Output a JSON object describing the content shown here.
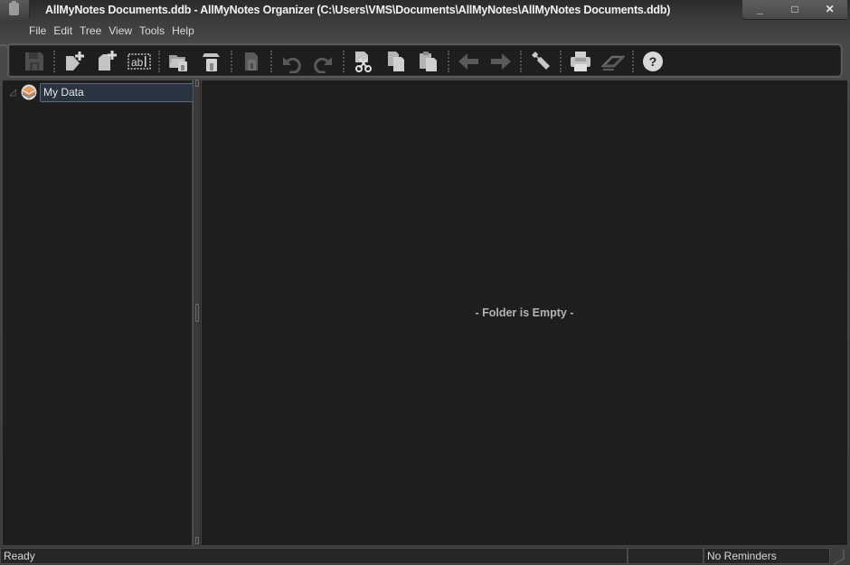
{
  "window": {
    "title": "AllMyNotes Documents.ddb - AllMyNotes Organizer (C:\\Users\\VMS\\Documents\\AllMyNotes\\AllMyNotes Documents.ddb)",
    "controls": {
      "minimize": "_",
      "maximize": "□",
      "close": "✕"
    }
  },
  "menu": {
    "items": [
      "File",
      "Edit",
      "Tree",
      "View",
      "Tools",
      "Help"
    ]
  },
  "toolbar": {
    "buttons": [
      {
        "icon": "save-icon",
        "enabled": false
      },
      {
        "icon": "new-folder-icon",
        "enabled": true
      },
      {
        "icon": "new-note-icon",
        "enabled": true
      },
      {
        "icon": "rename-icon",
        "enabled": true
      },
      {
        "icon": "open-folder-lock-icon",
        "enabled": true
      },
      {
        "icon": "lock-icon",
        "enabled": true
      },
      {
        "icon": "lock-document-icon",
        "enabled": false
      },
      {
        "icon": "undo-icon",
        "enabled": false
      },
      {
        "icon": "redo-icon",
        "enabled": false
      },
      {
        "icon": "cut-icon",
        "enabled": true
      },
      {
        "icon": "copy-icon",
        "enabled": true
      },
      {
        "icon": "paste-icon",
        "enabled": true
      },
      {
        "icon": "back-arrow-icon",
        "enabled": false
      },
      {
        "icon": "forward-arrow-icon",
        "enabled": false
      },
      {
        "icon": "wrench-icon",
        "enabled": true
      },
      {
        "icon": "print-icon",
        "enabled": true
      },
      {
        "icon": "scanner-icon",
        "enabled": false
      },
      {
        "icon": "help-icon",
        "enabled": true
      }
    ]
  },
  "tree": {
    "root": {
      "label": "My Data",
      "expanded": true,
      "selected": true
    }
  },
  "content": {
    "empty_message": "- Folder is Empty -"
  },
  "status": {
    "state": "Ready",
    "middle": "",
    "reminders": "No Reminders"
  },
  "colors": {
    "background": "#1e1e1e",
    "chrome": "#3c3c3c",
    "selection": "#2a3340",
    "text": "#dcdcdc",
    "accent_orange": "#e89a5a"
  }
}
